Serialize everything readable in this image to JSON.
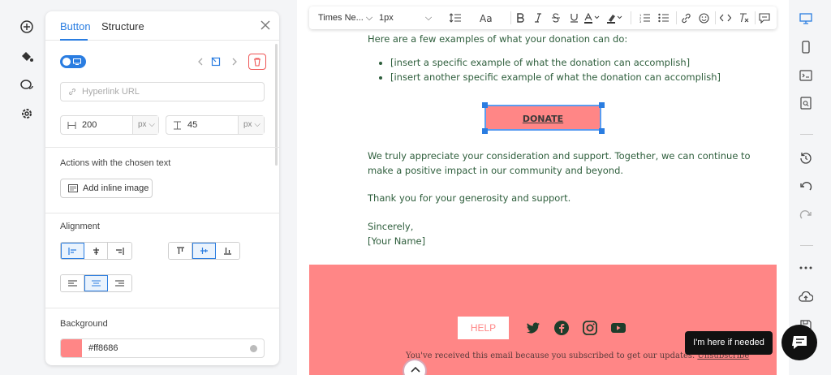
{
  "left_rail": {
    "icons": [
      "plus-circle-icon",
      "paint-bucket-icon",
      "chat-bubbles-icon",
      "gear-icon"
    ]
  },
  "panel": {
    "tabs": [
      "Button",
      "Structure"
    ],
    "active_tab": "Button",
    "link_placeholder": "Hyperlink URL",
    "width_value": "200",
    "width_unit": "px",
    "height_value": "45",
    "height_unit": "px",
    "actions_label": "Actions with the chosen text",
    "add_image_label": "Add inline image",
    "alignment_label": "Alignment",
    "background_label": "Background",
    "background_value": "#ff8686"
  },
  "toolbar": {
    "font_family": "Times Ne...",
    "font_size": "1px"
  },
  "email": {
    "intro": "Here are a few examples of what your donation can do:",
    "bullets": [
      "[insert a specific example of what the donation can accomplish]",
      "[insert another specific example of what the donation can accomplish]"
    ],
    "donate_label": "DONATE",
    "para1_line1": "We truly appreciate your consideration and support. Together, we can continue to",
    "para1_line2": "make a positive impact in our community and beyond.",
    "thanks": "Thank you for your generosity and support.",
    "sign_off": "Sincerely,",
    "name": "[Your Name]"
  },
  "footer": {
    "help_label": "HELP",
    "social": [
      "twitter-icon",
      "facebook-icon",
      "instagram-icon",
      "youtube-icon"
    ],
    "note": "You've received this email because you subscribed to get our updates.",
    "unsubscribe": "Unsubscribe"
  },
  "chat": {
    "tip": "I'm here if needed"
  },
  "colors": {
    "accent": "#2a7de1",
    "button_bg": "#ff8686",
    "text_green": "#2e5e3c"
  }
}
